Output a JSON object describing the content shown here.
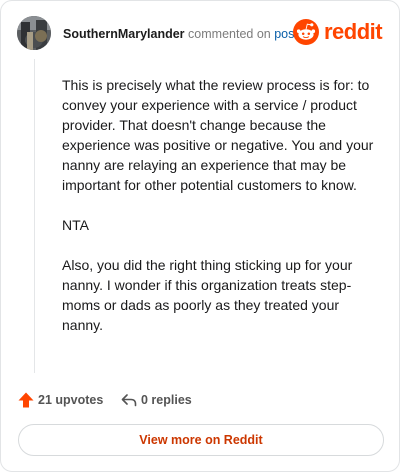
{
  "header": {
    "username": "SouthernMarylander",
    "action_text": "commented on",
    "post_link": "post",
    "brand_name": "reddit",
    "avatar_icon": "avatar-image",
    "brand_icon": "reddit-snoo-icon"
  },
  "comment": {
    "paragraphs": [
      "This is precisely what the review process is for: to convey your experience with a service / product provider. That doesn't change because the experience was positive or negative. You and your nanny are relaying an experience that may be important for other potential customers to know.",
      "NTA",
      "Also, you did the right thing sticking up for your nanny. I wonder if this organization treats step-moms or dads as poorly as they treated your nanny."
    ]
  },
  "actions": {
    "upvotes_label": "21 upvotes",
    "replies_label": "0 replies",
    "upvote_icon": "upvote-arrow-icon",
    "reply_icon": "reply-icon"
  },
  "footer": {
    "view_more_label": "View more on Reddit"
  },
  "colors": {
    "accent": "#ff4500",
    "link": "#0a5fa8",
    "button_text": "#cc3700"
  }
}
